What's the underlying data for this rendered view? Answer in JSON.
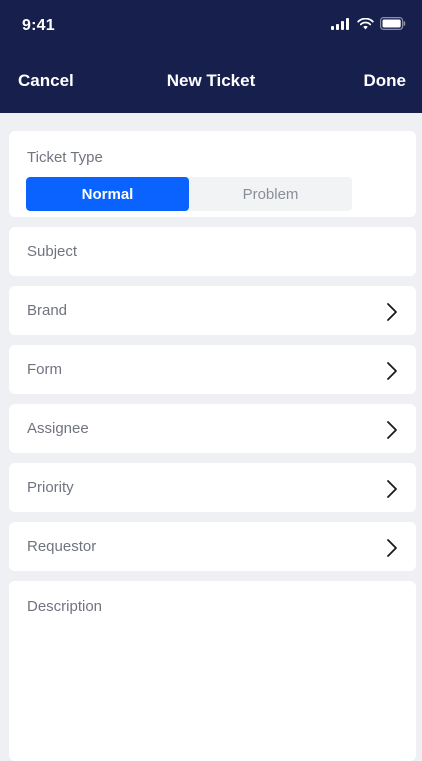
{
  "status_bar": {
    "time": "9:41"
  },
  "nav": {
    "cancel_label": "Cancel",
    "title": "New Ticket",
    "done_label": "Done"
  },
  "ticket_type": {
    "label": "Ticket Type",
    "options": [
      "Normal",
      "Problem"
    ],
    "selected": "Normal"
  },
  "fields": {
    "subject": "Subject",
    "brand": "Brand",
    "form": "Form",
    "assignee": "Assignee",
    "priority": "Priority",
    "requestor": "Requestor",
    "description": "Description"
  },
  "colors": {
    "header_bg": "#171f4d",
    "accent": "#0a62ff",
    "page_bg": "#eef0f3"
  }
}
